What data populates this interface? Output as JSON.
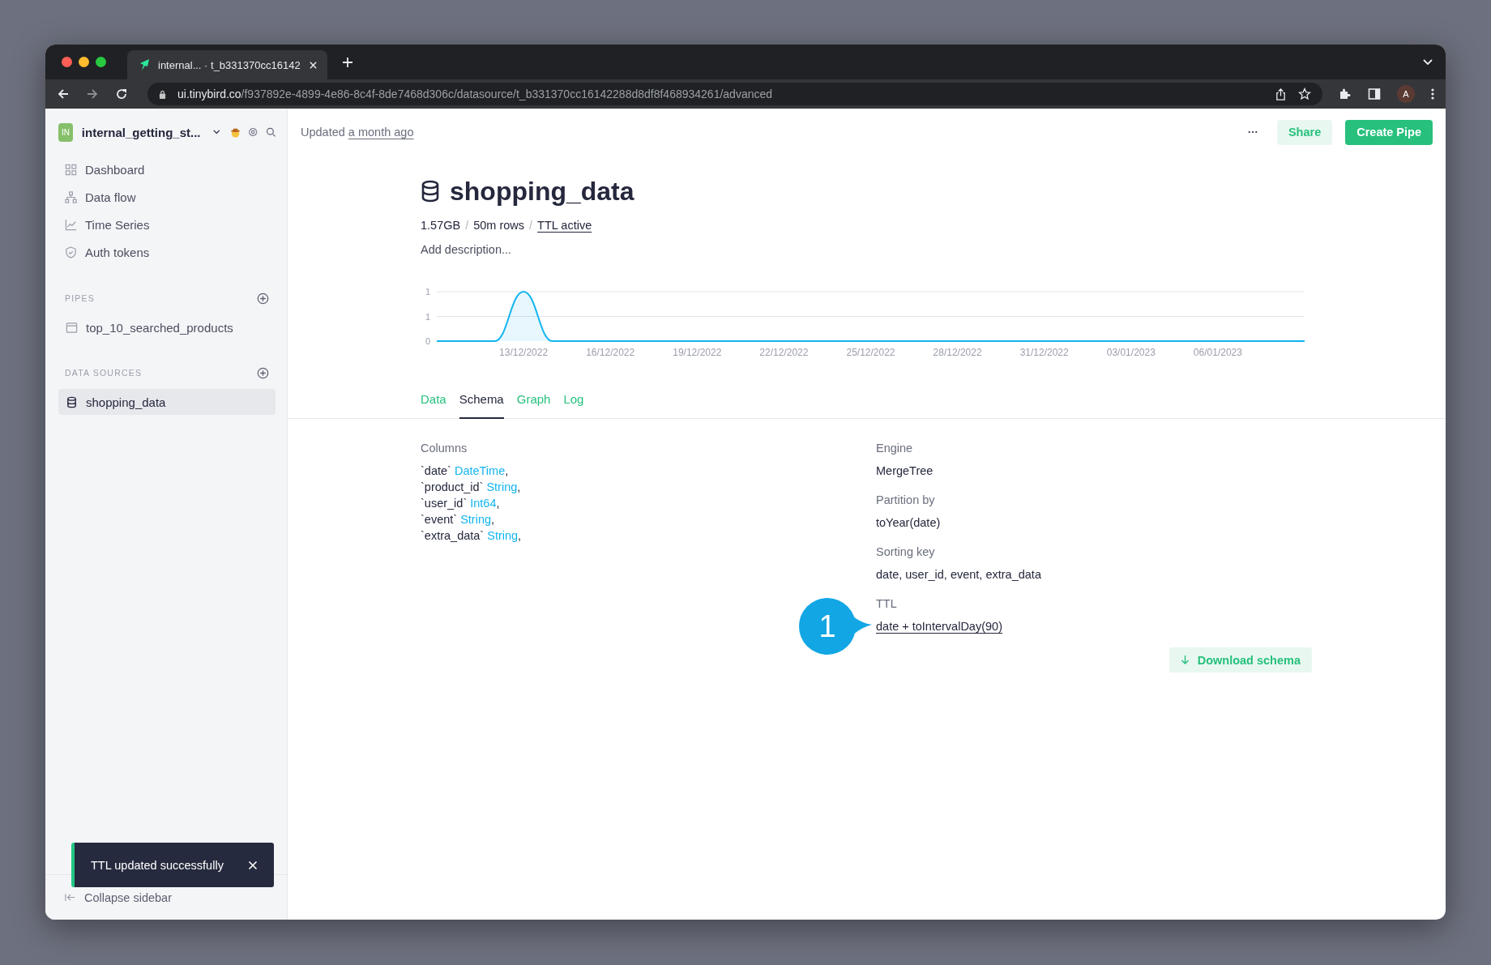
{
  "browser": {
    "tab_title": "internal... · t_b331370cc16142",
    "url_host": "ui.tinybird.co",
    "url_path": "/f937892e-4899-4e86-8c4f-8de7468d306c/datasource/t_b331370cc16142288d8df8f468934261/advanced",
    "avatar": "A"
  },
  "sidebar": {
    "workspace_badge": "IN",
    "workspace_name": "internal_getting_st...",
    "nav": [
      {
        "label": "Dashboard"
      },
      {
        "label": "Data flow"
      },
      {
        "label": "Time Series"
      },
      {
        "label": "Auth tokens"
      }
    ],
    "sections": [
      {
        "title": "PIPES",
        "items": [
          {
            "label": "top_10_searched_products",
            "kind": "pipe",
            "selected": false
          }
        ]
      },
      {
        "title": "DATA SOURCES",
        "items": [
          {
            "label": "shopping_data",
            "kind": "datasource",
            "selected": true
          }
        ]
      }
    ],
    "collapse": "Collapse sidebar"
  },
  "header": {
    "updated_prefix": "Updated",
    "updated_link": "a month ago",
    "share": "Share",
    "create": "Create Pipe"
  },
  "datasource": {
    "title": "shopping_data",
    "stats": [
      {
        "kind": "value",
        "text": "1.57GB"
      },
      {
        "kind": "separator",
        "text": "/"
      },
      {
        "kind": "value",
        "text": "50m rows"
      },
      {
        "kind": "separator",
        "text": "/"
      },
      {
        "kind": "link",
        "text": "TTL active"
      }
    ],
    "description": {
      "placeholder": "Add description..."
    },
    "chart_data": {
      "type": "area",
      "categories": [
        null,
        null,
        null,
        "13/12/2022",
        null,
        null,
        "16/12/2022",
        null,
        null,
        "19/12/2022",
        null,
        null,
        "22/12/2022",
        null,
        null,
        "25/12/2022",
        null,
        null,
        "28/12/2022",
        null,
        null,
        "31/12/2022",
        null,
        null,
        "03/01/2023",
        null,
        null,
        "06/01/2023",
        null,
        null,
        null
      ],
      "series": [
        {
          "color": "#12b5ef",
          "values": [
            0,
            0,
            0,
            1,
            0,
            0,
            0,
            0,
            0,
            0,
            0,
            0,
            0,
            0,
            0,
            0,
            0,
            0,
            0,
            0,
            0,
            0,
            0,
            0,
            0,
            0,
            0,
            0,
            0,
            0,
            0
          ]
        }
      ],
      "ylim": [
        0,
        1
      ],
      "yticks": [
        {
          "value": 0,
          "label": "0"
        },
        {
          "value": 0.5,
          "label": "1"
        },
        {
          "value": 1,
          "label": "1"
        }
      ]
    }
  },
  "tabs": [
    {
      "label": "Data",
      "selected": false
    },
    {
      "label": "Schema",
      "selected": true
    },
    {
      "label": "Graph",
      "selected": false
    },
    {
      "label": "Log",
      "selected": false
    }
  ],
  "schema": {
    "columns_label": "Columns",
    "columns": [
      {
        "name": "`date`",
        "type": "DateTime",
        "end": ","
      },
      {
        "name": "`product_id`",
        "type": "String",
        "end": ","
      },
      {
        "name": "`user_id`",
        "type": "Int64",
        "end": ","
      },
      {
        "name": "`event`",
        "type": "String",
        "end": ","
      },
      {
        "name": "`extra_data`",
        "type": "String",
        "end": ","
      }
    ],
    "properties": [
      {
        "label": "Engine",
        "value": "MergeTree",
        "link": false
      },
      {
        "label": "Partition by",
        "value": "toYear(date)",
        "link": false
      },
      {
        "label": "Sorting key",
        "value": "date, user_id, event, extra_data",
        "link": false
      },
      {
        "label": "TTL",
        "value": "date + toIntervalDay(90)",
        "link": true,
        "callout": "1"
      }
    ],
    "download": "Download schema"
  },
  "toast": {
    "message": "TTL updated successfully"
  }
}
